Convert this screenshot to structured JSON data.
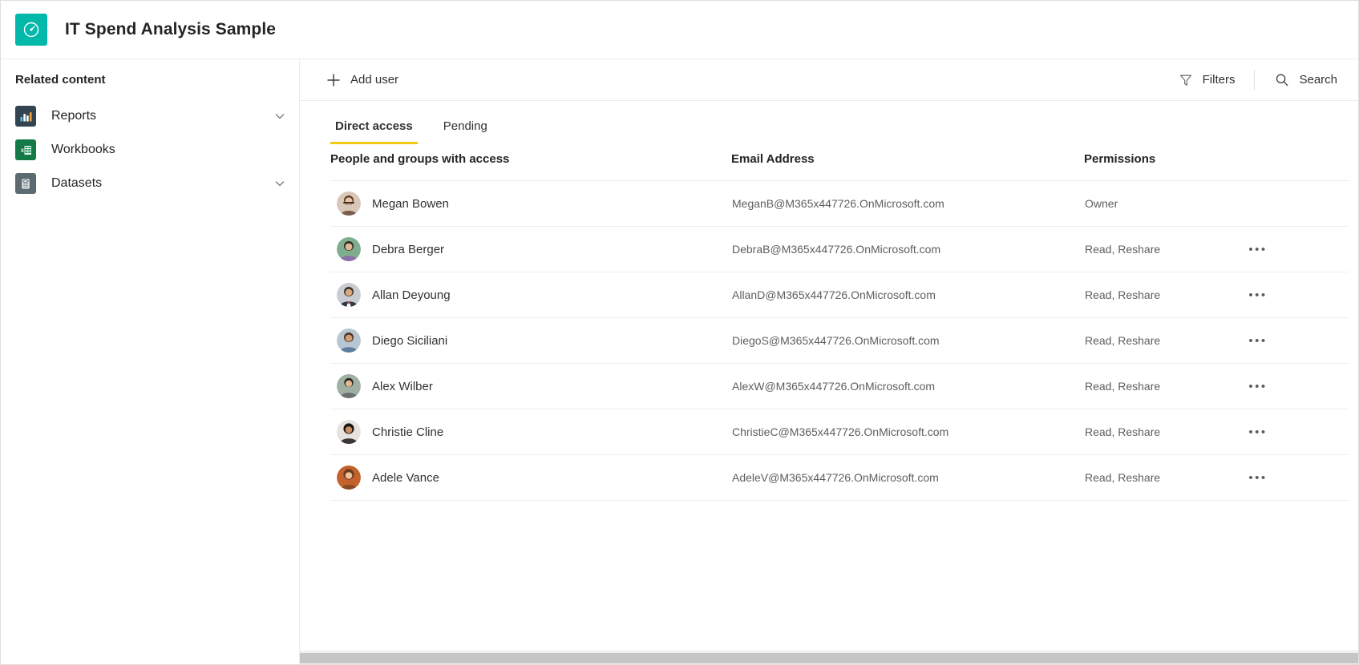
{
  "header": {
    "title": "IT Spend Analysis Sample",
    "logo_icon": "dashboard-gauge-icon",
    "logo_color": "#01b8aa"
  },
  "sidebar": {
    "title": "Related content",
    "items": [
      {
        "label": "Reports",
        "icon": "bar-chart-icon",
        "icon_color": "#31444f",
        "has_chevron": true
      },
      {
        "label": "Workbooks",
        "icon": "excel-workbook-icon",
        "icon_color": "#137a48",
        "has_chevron": false
      },
      {
        "label": "Datasets",
        "icon": "database-icon",
        "icon_color": "#5b6b71",
        "has_chevron": true
      }
    ]
  },
  "commandbar": {
    "add_user_label": "Add user",
    "add_user_icon": "plus-icon",
    "filters_label": "Filters",
    "filters_icon": "funnel-icon",
    "search_label": "Search",
    "search_icon": "search-icon"
  },
  "tabs": [
    {
      "label": "Direct access",
      "active": true
    },
    {
      "label": "Pending",
      "active": false
    }
  ],
  "tab_accent_color": "#f2c811",
  "table": {
    "columns": [
      "People and groups with access",
      "Email Address",
      "Permissions",
      ""
    ],
    "rows": [
      {
        "name": "Megan Bowen",
        "email": "MeganB@M365x447726.OnMicrosoft.com",
        "permissions": "Owner",
        "menu": "",
        "has_menu": false
      },
      {
        "name": "Debra Berger",
        "email": "DebraB@M365x447726.OnMicrosoft.com",
        "permissions": "Read, Reshare",
        "menu": "•••",
        "has_menu": true
      },
      {
        "name": "Allan Deyoung",
        "email": "AllanD@M365x447726.OnMicrosoft.com",
        "permissions": "Read, Reshare",
        "menu": "•••",
        "has_menu": true
      },
      {
        "name": "Diego Siciliani",
        "email": "DiegoS@M365x447726.OnMicrosoft.com",
        "permissions": "Read, Reshare",
        "menu": "•••",
        "has_menu": true
      },
      {
        "name": "Alex Wilber",
        "email": "AlexW@M365x447726.OnMicrosoft.com",
        "permissions": "Read, Reshare",
        "menu": "•••",
        "has_menu": true
      },
      {
        "name": "Christie Cline",
        "email": "ChristieC@M365x447726.OnMicrosoft.com",
        "permissions": "Read, Reshare",
        "menu": "•••",
        "has_menu": true
      },
      {
        "name": "Adele Vance",
        "email": "AdeleV@M365x447726.OnMicrosoft.com",
        "permissions": "Read, Reshare",
        "menu": "•••",
        "has_menu": true
      }
    ]
  }
}
